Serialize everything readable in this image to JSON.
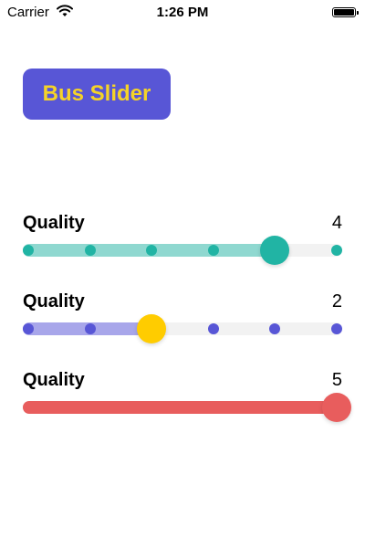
{
  "status_bar": {
    "carrier": "Carrier",
    "time": "1:26 PM",
    "signal_icon": "wifi-icon",
    "battery_icon": "battery-icon"
  },
  "bus_button": {
    "label": "Bus Slider",
    "background": "#5856D6",
    "text_color": "#F5D328"
  },
  "sliders": [
    {
      "label": "Quality",
      "value": "4",
      "level": 4,
      "max": 5,
      "step_dots": true,
      "fill_color": "#8FD8D0",
      "dot_color": "#21B4A4",
      "thumb_color": "#21B4A4"
    },
    {
      "label": "Quality",
      "value": "2",
      "level": 2,
      "max": 5,
      "step_dots": true,
      "fill_color": "#A8A6EA",
      "dot_color": "#5856D6",
      "thumb_color": "#FFCC00"
    },
    {
      "label": "Quality",
      "value": "5",
      "level": 5,
      "max": 5,
      "step_dots": false,
      "fill_color": "#E85D5D",
      "dot_color": "#E85D5D",
      "thumb_color": "#E85D5D"
    }
  ]
}
